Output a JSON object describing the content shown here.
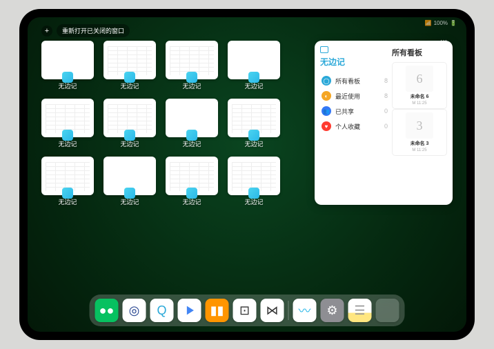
{
  "statusbar": {
    "signal": "📶",
    "wifi": "100%",
    "battery": "🔋"
  },
  "toolbar": {
    "plus": "+",
    "button": "重新打开已关闭的窗口"
  },
  "grid": {
    "items": [
      {
        "label": "无边记",
        "variant": "blank"
      },
      {
        "label": "无边记",
        "variant": "cal"
      },
      {
        "label": "无边记",
        "variant": "cal"
      },
      {
        "label": "无边记",
        "variant": "blank"
      },
      {
        "label": "无边记",
        "variant": "cal"
      },
      {
        "label": "无边记",
        "variant": "cal"
      },
      {
        "label": "无边记",
        "variant": "blank"
      },
      {
        "label": "无边记",
        "variant": "cal"
      },
      {
        "label": "无边记",
        "variant": "cal"
      },
      {
        "label": "无边记",
        "variant": "blank"
      },
      {
        "label": "无边记",
        "variant": "cal"
      },
      {
        "label": "无边记",
        "variant": "cal"
      }
    ]
  },
  "panel": {
    "title": "无边记",
    "right_title": "所有看板",
    "categories": [
      {
        "icon": "◯",
        "color": "#2aa8d8",
        "label": "所有看板",
        "count": "8"
      },
      {
        "icon": "◐",
        "color": "#f5a623",
        "label": "最近使用",
        "count": "8"
      },
      {
        "icon": "👥",
        "color": "#3478f6",
        "label": "已共享",
        "count": "0"
      },
      {
        "icon": "♥",
        "color": "#ff3b30",
        "label": "个人收藏",
        "count": "0"
      }
    ],
    "boards": [
      {
        "glyph": "6",
        "label": "未命名 6",
        "sub": "M 11:25"
      },
      {
        "glyph": "3",
        "label": "未命名 3",
        "sub": "M 11:25"
      }
    ]
  },
  "dock": [
    {
      "name": "wechat",
      "bg": "#07c160",
      "glyph": "●●"
    },
    {
      "name": "browser-hd",
      "bg": "#fff",
      "glyph": "◎"
    },
    {
      "name": "qqbrowser",
      "bg": "#fff",
      "glyph": "Q"
    },
    {
      "name": "video",
      "bg": "#fff",
      "glyph": "▶"
    },
    {
      "name": "books",
      "bg": "#ff9500",
      "glyph": "▮▮"
    },
    {
      "name": "dice",
      "bg": "#fff",
      "glyph": "⊡"
    },
    {
      "name": "connect",
      "bg": "#fff",
      "glyph": "⋈"
    },
    {
      "name": "freeform",
      "bg": "#fff",
      "glyph": "〰"
    },
    {
      "name": "settings",
      "bg": "#8e8e93",
      "glyph": "⚙"
    },
    {
      "name": "notes",
      "bg": "#fff",
      "glyph": "☰"
    },
    {
      "name": "multitask",
      "bg": "multi",
      "glyph": ""
    }
  ]
}
